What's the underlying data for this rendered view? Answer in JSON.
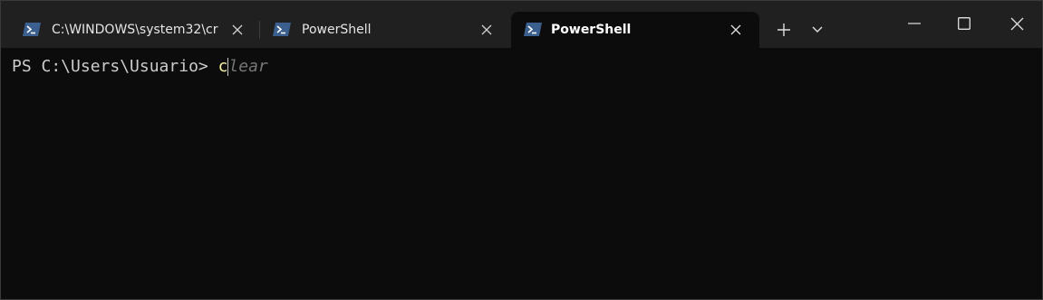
{
  "tabs": [
    {
      "label": "C:\\WINDOWS\\system32\\cr",
      "icon": "powershell-icon",
      "active": false
    },
    {
      "label": "PowerShell",
      "icon": "powershell-icon",
      "active": false
    },
    {
      "label": "PowerShell",
      "icon": "powershell-icon",
      "active": true
    }
  ],
  "terminal": {
    "prompt": "PS C:\\Users\\Usuario> ",
    "typed": "c",
    "suggestion": "lear"
  },
  "colors": {
    "titlebar": "#202020",
    "terminal_bg": "#0c0c0c",
    "prompt_text": "#cccccc",
    "typed_text": "#f9f1a5",
    "suggestion_text": "#767676"
  }
}
